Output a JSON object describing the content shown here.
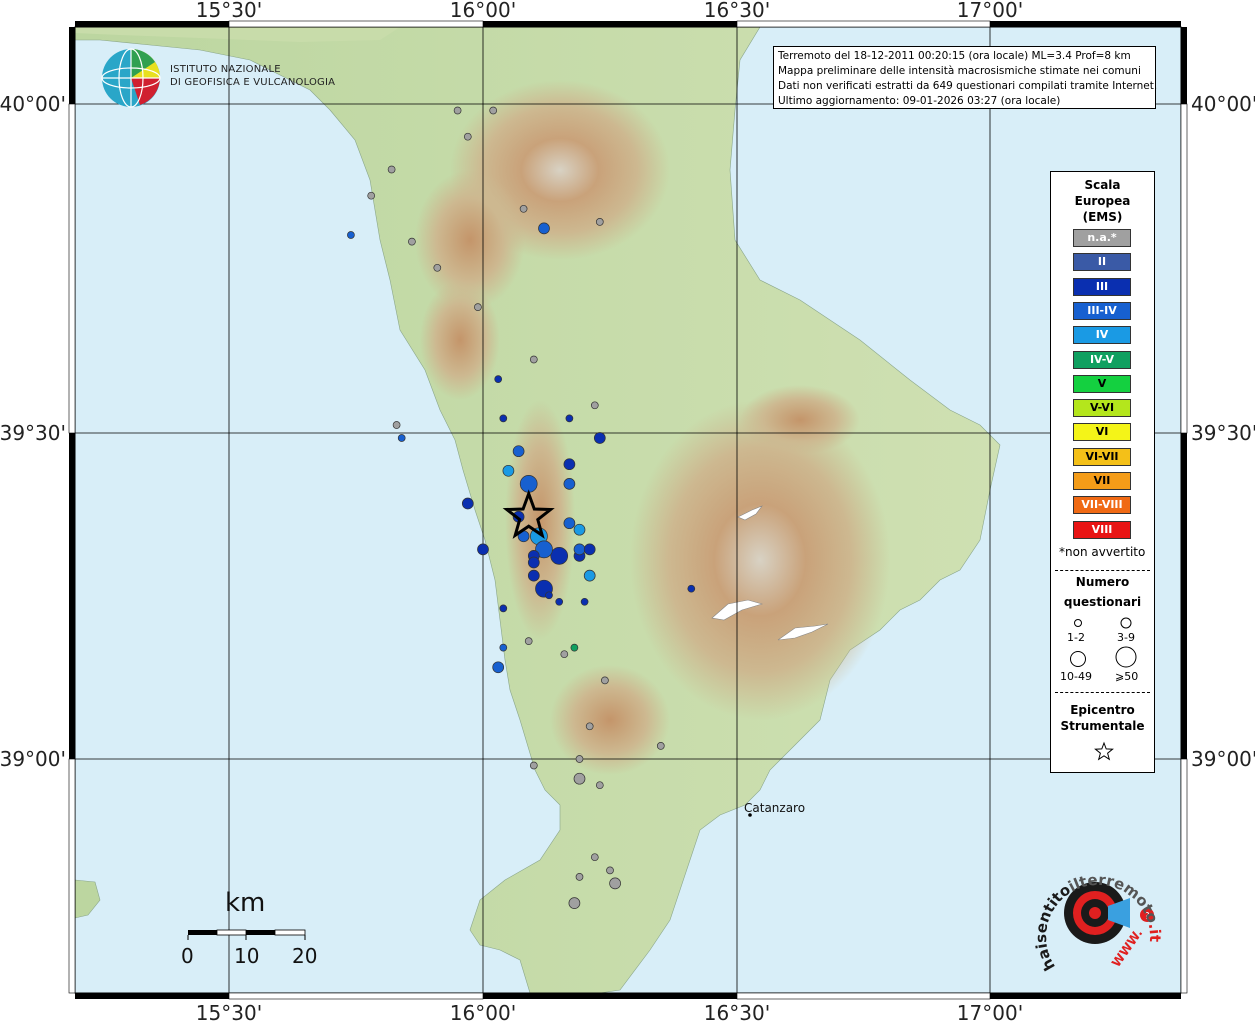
{
  "map": {
    "lon_ticks": [
      "15°30'",
      "16°00'",
      "16°30'",
      "17°00'"
    ],
    "lat_ticks": [
      "40°00'",
      "39°30'",
      "39°00'"
    ],
    "city": "Catanzaro"
  },
  "logo": {
    "line1": "ISTITUTO NAZIONALE",
    "line2": "DI GEOFISICA E VULCANOLOGIA"
  },
  "info": {
    "line1": "Terremoto del 18-12-2011 00:20:15 (ora locale) ML=3.4 Prof=8 km",
    "line2": "Mappa preliminare delle intensità macrosismiche stimate nei comuni",
    "line3": "Dati non verificati estratti da 649 questionari compilati tramite Internet.",
    "line4": "Ultimo aggiornamento: 09-01-2026 03:27 (ora locale)"
  },
  "legend": {
    "title1": "Scala",
    "title2": "Europea",
    "title3": "(EMS)",
    "classes": [
      {
        "label": "n.a.*",
        "color": "#a0a0a0"
      },
      {
        "label": "II",
        "color": "#3a5aa6"
      },
      {
        "label": "III",
        "color": "#0a2fb0"
      },
      {
        "label": "III-IV",
        "color": "#1760d0"
      },
      {
        "label": "IV",
        "color": "#1a9ae4"
      },
      {
        "label": "IV-V",
        "color": "#10a060"
      },
      {
        "label": "V",
        "color": "#14d040"
      },
      {
        "label": "V-VI",
        "color": "#b4e61c"
      },
      {
        "label": "VI",
        "color": "#f4f418"
      },
      {
        "label": "VI-VII",
        "color": "#f4c018"
      },
      {
        "label": "VII",
        "color": "#f49c18"
      },
      {
        "label": "VII-VIII",
        "color": "#f06a14"
      },
      {
        "label": "VIII",
        "color": "#e81414"
      }
    ],
    "note": "*non avvertito",
    "count_title1": "Numero",
    "count_title2": "questionari",
    "counts": [
      "1-2",
      "3-9",
      "10-49",
      "⩾50"
    ],
    "epi_title1": "Epicentro",
    "epi_title2": "Strumentale"
  },
  "scale": {
    "unit": "km",
    "labels": [
      "0",
      "10",
      "20"
    ]
  },
  "site": {
    "text1": "haisentito",
    "text2": "ilterremoto",
    "text3": ".it",
    "text4": "WWW."
  },
  "points": [
    {
      "lon": 15.82,
      "lat": 39.9,
      "cls": "n.a.*",
      "n": 1
    },
    {
      "lon": 15.97,
      "lat": 39.95,
      "cls": "n.a.*",
      "n": 1
    },
    {
      "lon": 16.02,
      "lat": 39.99,
      "cls": "n.a.*",
      "n": 1
    },
    {
      "lon": 15.95,
      "lat": 39.99,
      "cls": "n.a.*",
      "n": 1
    },
    {
      "lon": 15.78,
      "lat": 39.86,
      "cls": "n.a.*",
      "n": 1
    },
    {
      "lon": 15.86,
      "lat": 39.79,
      "cls": "n.a.*",
      "n": 1
    },
    {
      "lon": 16.08,
      "lat": 39.84,
      "cls": "n.a.*",
      "n": 1
    },
    {
      "lon": 16.12,
      "lat": 39.81,
      "cls": "III-IV",
      "n": 5
    },
    {
      "lon": 16.23,
      "lat": 39.82,
      "cls": "n.a.*",
      "n": 1
    },
    {
      "lon": 15.74,
      "lat": 39.8,
      "cls": "III-IV",
      "n": 1
    },
    {
      "lon": 15.91,
      "lat": 39.75,
      "cls": "n.a.*",
      "n": 1
    },
    {
      "lon": 15.99,
      "lat": 39.69,
      "cls": "n.a.*",
      "n": 1
    },
    {
      "lon": 16.22,
      "lat": 39.54,
      "cls": "n.a.*",
      "n": 1
    },
    {
      "lon": 16.1,
      "lat": 39.61,
      "cls": "n.a.*",
      "n": 1
    },
    {
      "lon": 15.83,
      "lat": 39.51,
      "cls": "n.a.*",
      "n": 1
    },
    {
      "lon": 15.84,
      "lat": 39.49,
      "cls": "III-IV",
      "n": 1
    },
    {
      "lon": 16.04,
      "lat": 39.52,
      "cls": "III",
      "n": 1
    },
    {
      "lon": 16.17,
      "lat": 39.52,
      "cls": "III",
      "n": 1
    },
    {
      "lon": 16.03,
      "lat": 39.58,
      "cls": "III",
      "n": 1
    },
    {
      "lon": 16.23,
      "lat": 39.49,
      "cls": "III",
      "n": 4
    },
    {
      "lon": 16.07,
      "lat": 39.47,
      "cls": "III-IV",
      "n": 5
    },
    {
      "lon": 16.05,
      "lat": 39.44,
      "cls": "IV",
      "n": 6
    },
    {
      "lon": 16.09,
      "lat": 39.42,
      "cls": "III-IV",
      "n": 12
    },
    {
      "lon": 16.17,
      "lat": 39.45,
      "cls": "III",
      "n": 5
    },
    {
      "lon": 16.17,
      "lat": 39.42,
      "cls": "III-IV",
      "n": 4
    },
    {
      "lon": 15.97,
      "lat": 39.39,
      "cls": "III",
      "n": 6
    },
    {
      "lon": 16.07,
      "lat": 39.37,
      "cls": "III",
      "n": 5
    },
    {
      "lon": 16.17,
      "lat": 39.36,
      "cls": "III-IV",
      "n": 5
    },
    {
      "lon": 16.19,
      "lat": 39.35,
      "cls": "IV",
      "n": 4
    },
    {
      "lon": 16.08,
      "lat": 39.34,
      "cls": "III-IV",
      "n": 6
    },
    {
      "lon": 16.11,
      "lat": 39.34,
      "cls": "IV",
      "n": 16
    },
    {
      "lon": 16.0,
      "lat": 39.32,
      "cls": "III",
      "n": 6
    },
    {
      "lon": 16.1,
      "lat": 39.31,
      "cls": "III",
      "n": 8
    },
    {
      "lon": 16.1,
      "lat": 39.3,
      "cls": "III",
      "n": 5
    },
    {
      "lon": 16.12,
      "lat": 39.32,
      "cls": "III-IV",
      "n": 10
    },
    {
      "lon": 16.15,
      "lat": 39.31,
      "cls": "III",
      "n": 20
    },
    {
      "lon": 16.19,
      "lat": 39.32,
      "cls": "III-IV",
      "n": 5
    },
    {
      "lon": 16.19,
      "lat": 39.31,
      "cls": "III",
      "n": 8
    },
    {
      "lon": 16.21,
      "lat": 39.32,
      "cls": "III",
      "n": 5
    },
    {
      "lon": 16.21,
      "lat": 39.28,
      "cls": "IV",
      "n": 8
    },
    {
      "lon": 16.1,
      "lat": 39.28,
      "cls": "III",
      "n": 6
    },
    {
      "lon": 16.12,
      "lat": 39.26,
      "cls": "III",
      "n": 12
    },
    {
      "lon": 16.13,
      "lat": 39.25,
      "cls": "III",
      "n": 2
    },
    {
      "lon": 16.15,
      "lat": 39.24,
      "cls": "III",
      "n": 1
    },
    {
      "lon": 16.2,
      "lat": 39.24,
      "cls": "III",
      "n": 1
    },
    {
      "lon": 16.41,
      "lat": 39.26,
      "cls": "III",
      "n": 1
    },
    {
      "lon": 16.04,
      "lat": 39.23,
      "cls": "III",
      "n": 1
    },
    {
      "lon": 16.04,
      "lat": 39.17,
      "cls": "III-IV",
      "n": 1
    },
    {
      "lon": 16.09,
      "lat": 39.18,
      "cls": "n.a.*",
      "n": 1
    },
    {
      "lon": 16.16,
      "lat": 39.16,
      "cls": "n.a.*",
      "n": 1
    },
    {
      "lon": 16.18,
      "lat": 39.17,
      "cls": "IV-V",
      "n": 1
    },
    {
      "lon": 16.03,
      "lat": 39.14,
      "cls": "III-IV",
      "n": 6
    },
    {
      "lon": 16.24,
      "lat": 39.12,
      "cls": "n.a.*",
      "n": 1
    },
    {
      "lon": 16.21,
      "lat": 39.05,
      "cls": "n.a.*",
      "n": 1
    },
    {
      "lon": 16.35,
      "lat": 39.02,
      "cls": "n.a.*",
      "n": 1
    },
    {
      "lon": 16.19,
      "lat": 39.0,
      "cls": "n.a.*",
      "n": 1
    },
    {
      "lon": 16.1,
      "lat": 38.99,
      "cls": "n.a.*",
      "n": 1
    },
    {
      "lon": 16.19,
      "lat": 38.97,
      "cls": "n.a.*",
      "n": 4
    },
    {
      "lon": 16.23,
      "lat": 38.96,
      "cls": "n.a.*",
      "n": 1
    },
    {
      "lon": 16.22,
      "lat": 38.85,
      "cls": "n.a.*",
      "n": 1
    },
    {
      "lon": 16.25,
      "lat": 38.83,
      "cls": "n.a.*",
      "n": 1
    },
    {
      "lon": 16.19,
      "lat": 38.82,
      "cls": "n.a.*",
      "n": 1
    },
    {
      "lon": 16.26,
      "lat": 38.81,
      "cls": "n.a.*",
      "n": 4
    },
    {
      "lon": 16.18,
      "lat": 38.78,
      "cls": "n.a.*",
      "n": 4
    }
  ],
  "epicenter": {
    "lon": 16.09,
    "lat": 39.37
  }
}
